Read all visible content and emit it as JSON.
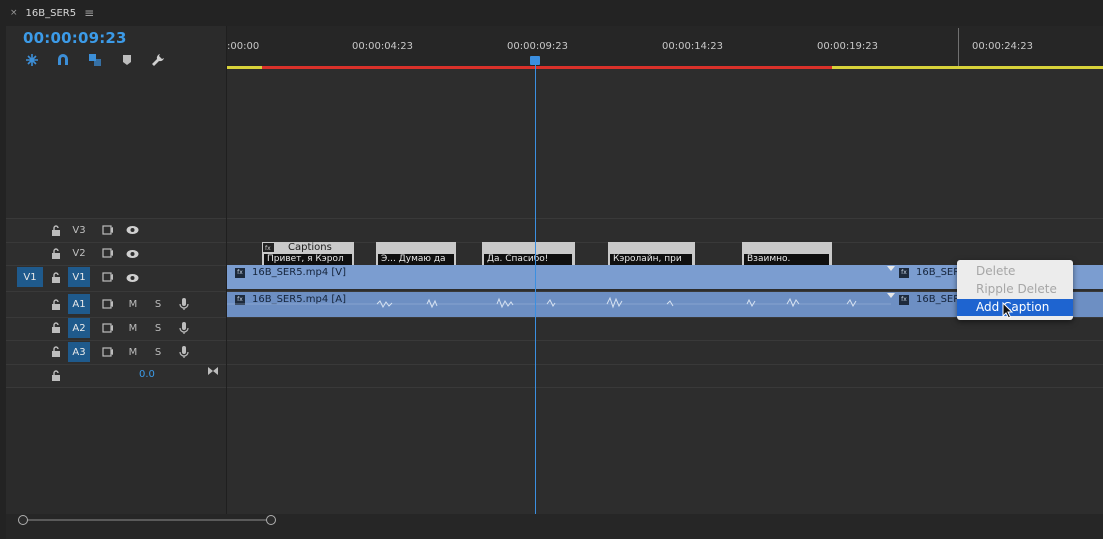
{
  "tab": {
    "close_label": "×",
    "title": "16B_SER5",
    "menu_label": "≡"
  },
  "timecode": "00:00:09:23",
  "tools": [
    {
      "name": "insert-sequence-tool-icon"
    },
    {
      "name": "snap-magnet-icon"
    },
    {
      "name": "linked-selection-icon"
    },
    {
      "name": "add-marker-icon"
    },
    {
      "name": "wrench-settings-icon"
    }
  ],
  "ruler": {
    "labels": [
      ":00:00",
      "00:00:04:23",
      "00:00:09:23",
      "00:00:14:23",
      "00:00:19:23",
      "00:00:24:23"
    ]
  },
  "tracks": {
    "video": [
      {
        "name": "V3"
      },
      {
        "name": "V2"
      },
      {
        "name": "V1",
        "source_patch": "V1"
      }
    ],
    "audio": [
      {
        "name": "A1",
        "mute": "M",
        "solo": "S"
      },
      {
        "name": "A2",
        "mute": "M",
        "solo": "S"
      },
      {
        "name": "A3",
        "mute": "M",
        "solo": "S"
      }
    ],
    "master_value": "0.0"
  },
  "captions": {
    "header": "Captions",
    "items": [
      "Привет, я Кэрол",
      "Э... Думаю да",
      "Да. Спасибо!",
      "Кэролайн, при",
      "Взаимно."
    ]
  },
  "clips": {
    "video_name": "16B_SER5.mp4 [V]",
    "audio_name": "16B_SER5.mp4 [A]",
    "video_name_2": "16B_SER",
    "audio_name_2": "16B_SER"
  },
  "context_menu": {
    "items": [
      {
        "label": "Delete",
        "enabled": false
      },
      {
        "label": "Ripple Delete",
        "enabled": false
      },
      {
        "label": "Add Caption",
        "enabled": true,
        "selected": true
      }
    ]
  },
  "colors": {
    "accent": "#3c9be8",
    "work_area_red": "#d9312a",
    "work_area_yellow": "#d8d23a",
    "clip_video": "#7b9dd0",
    "clip_audio": "#6d8fc3",
    "menu_highlight": "#1e64d0"
  }
}
